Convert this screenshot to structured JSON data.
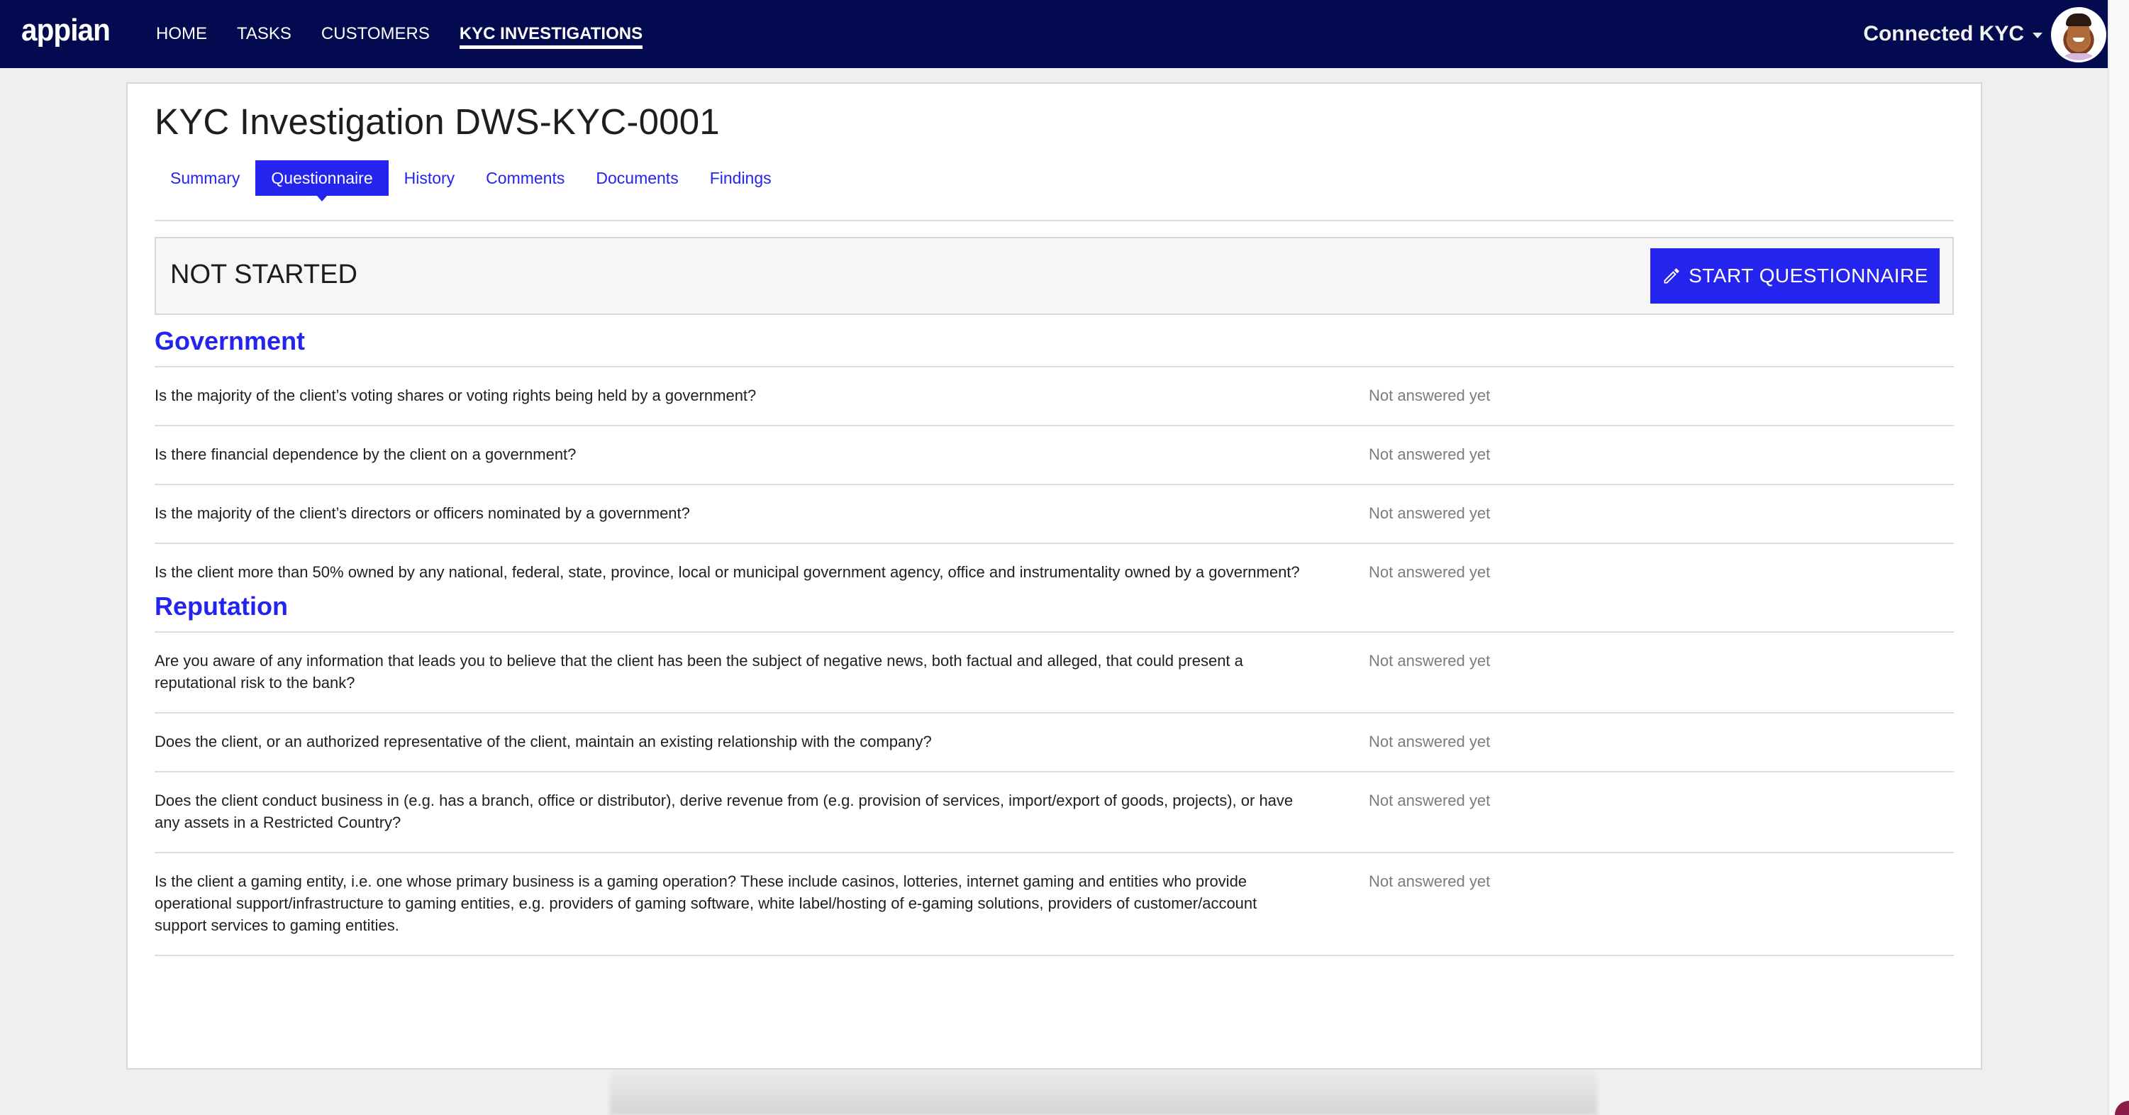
{
  "app": {
    "logo": "appian",
    "nav": [
      {
        "label": "HOME",
        "active": false
      },
      {
        "label": "TASKS",
        "active": false
      },
      {
        "label": "CUSTOMERS",
        "active": false
      },
      {
        "label": "KYC INVESTIGATIONS",
        "active": true
      }
    ],
    "user_menu": {
      "label": "Connected KYC",
      "icon": "caret-down-icon",
      "avatar": "user-avatar"
    }
  },
  "page": {
    "title": "KYC Investigation DWS-KYC-0001",
    "tabs": [
      {
        "label": "Summary",
        "active": false
      },
      {
        "label": "Questionnaire",
        "active": true
      },
      {
        "label": "History",
        "active": false
      },
      {
        "label": "Comments",
        "active": false
      },
      {
        "label": "Documents",
        "active": false
      },
      {
        "label": "Findings",
        "active": false
      }
    ],
    "status": "NOT STARTED",
    "start_button": {
      "label": "START QUESTIONNAIRE",
      "icon": "pencil-icon"
    },
    "accent_color": "#2424ee"
  },
  "sections": [
    {
      "heading": "Government",
      "questions": [
        {
          "text": "Is the majority of the client’s voting shares or voting rights being held by a government?",
          "answer": "Not answered yet"
        },
        {
          "text": "Is there financial dependence by the client on a government?",
          "answer": "Not answered yet"
        },
        {
          "text": "Is the majority of the client’s directors or officers nominated by a government?",
          "answer": "Not answered yet"
        },
        {
          "text": "Is the client more than 50% owned by any national, federal, state, province, local or municipal government agency, office and instrumentality owned by a government?",
          "answer": "Not answered yet"
        }
      ]
    },
    {
      "heading": "Reputation",
      "questions": [
        {
          "text": "Are you aware of any information that leads you to believe that the client has been the subject of negative news, both factual and alleged, that could present a reputational risk to the bank?",
          "answer": "Not answered yet"
        },
        {
          "text": "Does the client, or an authorized representative of the client, maintain an existing relationship with the company?",
          "answer": "Not answered yet"
        },
        {
          "text": "Does the client conduct business in (e.g. has a branch, office or distributor), derive revenue from (e.g. provision of services, import/export of goods, projects), or have any assets in a Restricted Country?",
          "answer": "Not answered yet"
        },
        {
          "text": "Is the client a gaming entity, i.e. one whose primary business is a gaming operation? These include casinos, lotteries, internet gaming and entities who provide operational support/infrastructure to gaming entities, e.g. providers of gaming software, white label/hosting of e-gaming solutions, providers of customer/account support services to gaming entities.",
          "answer": "Not answered yet"
        }
      ]
    }
  ]
}
